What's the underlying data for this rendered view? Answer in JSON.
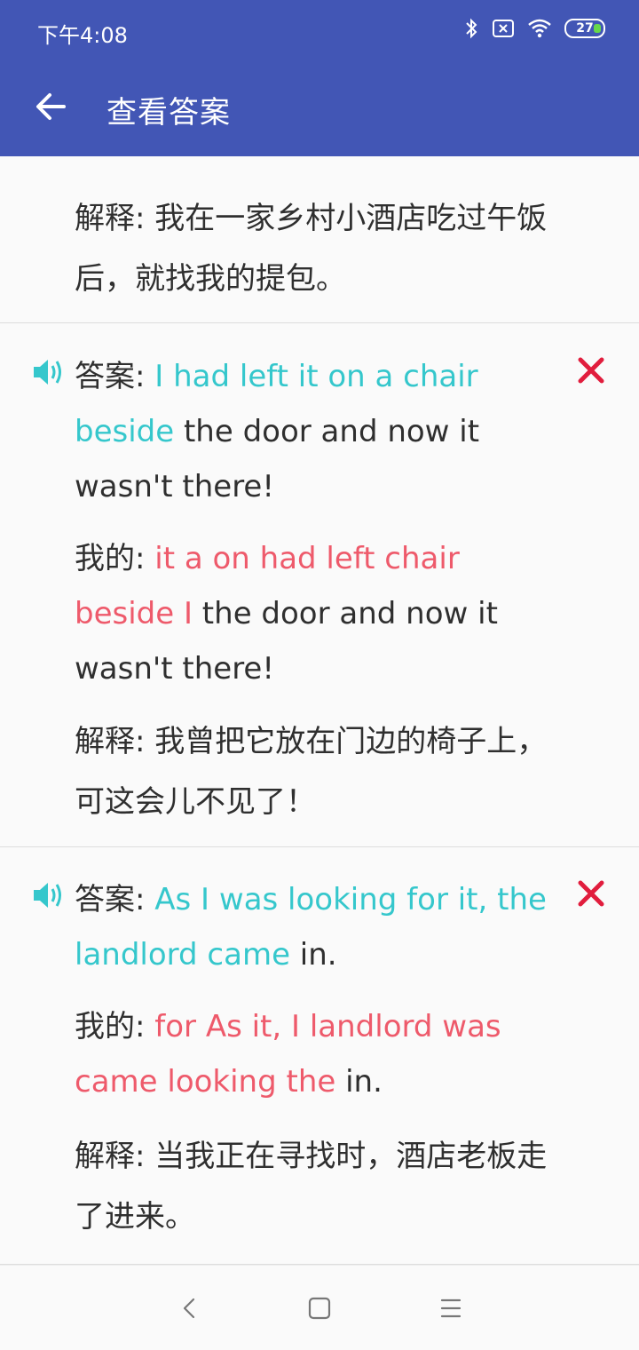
{
  "status": {
    "time": "下午4:08",
    "battery": "27",
    "icons": [
      "bluetooth-icon",
      "sim-icon",
      "wifi-icon",
      "battery-icon"
    ]
  },
  "app_bar": {
    "title": "查看答案"
  },
  "partial_row": {
    "explain_label": "解释: ",
    "explain_text": "我在一家乡村小酒店吃过午饭后，就找我的提包。"
  },
  "items": [
    {
      "answer_label": "答案: ",
      "answer_highlight": "I had left it on a chair beside",
      "answer_rest": " the door and now it wasn't there!",
      "mine_label": "我的: ",
      "mine_highlight": "it a on had left chair beside I",
      "mine_rest": " the door and now it wasn't there!",
      "explain_label": "解释: ",
      "explain_text": "我曾把它放在门边的椅子上，可这会儿不见了！"
    },
    {
      "answer_label": "答案: ",
      "answer_highlight": "As I was looking for it, the landlord came",
      "answer_rest": " in.",
      "mine_label": "我的: ",
      "mine_highlight": "for As it, I landlord was came looking the",
      "mine_rest": " in.",
      "explain_label": "解释: ",
      "explain_text": "当我正在寻找时，酒店老板走了进来。"
    }
  ],
  "colors": {
    "app_bar": "#4256b5",
    "correct": "#35c7cc",
    "wrong": "#ee5a6b",
    "wrong_mark": "#e11d3d"
  }
}
